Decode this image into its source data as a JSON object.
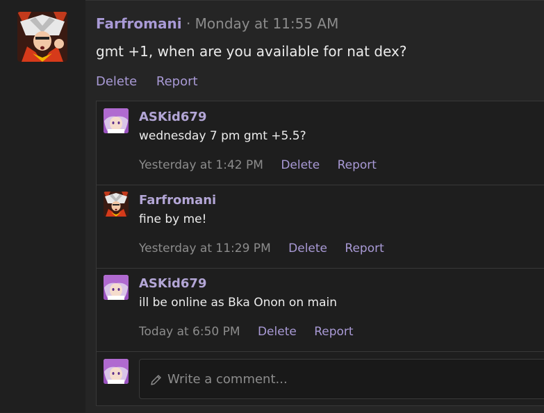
{
  "post": {
    "author": "Farfromani",
    "separator": "·",
    "time": "Monday at 11:55 AM",
    "body": "gmt +1, when are you available for nat dex?",
    "delete_label": "Delete",
    "report_label": "Report"
  },
  "comments": [
    {
      "author": "ASKid679",
      "text": "wednesday 7 pm gmt +5.5?",
      "time": "Yesterday at 1:42 PM",
      "delete_label": "Delete",
      "report_label": "Report",
      "avatar": "askid-avatar"
    },
    {
      "author": "Farfromani",
      "text": "fine by me!",
      "time": "Yesterday at 11:29 PM",
      "delete_label": "Delete",
      "report_label": "Report",
      "avatar": "farfromani-avatar"
    },
    {
      "author": "ASKid679",
      "text": "ill be online as Bka Onon on main",
      "time": "Today at 6:50 PM",
      "delete_label": "Delete",
      "report_label": "Report",
      "avatar": "askid-avatar"
    }
  ],
  "composer": {
    "placeholder": "Write a comment...",
    "icon": "pencil-icon"
  },
  "colors": {
    "background": "#232323",
    "author": "#b3a6d6",
    "link": "#a99ad6",
    "muted": "#8c8c8c"
  }
}
